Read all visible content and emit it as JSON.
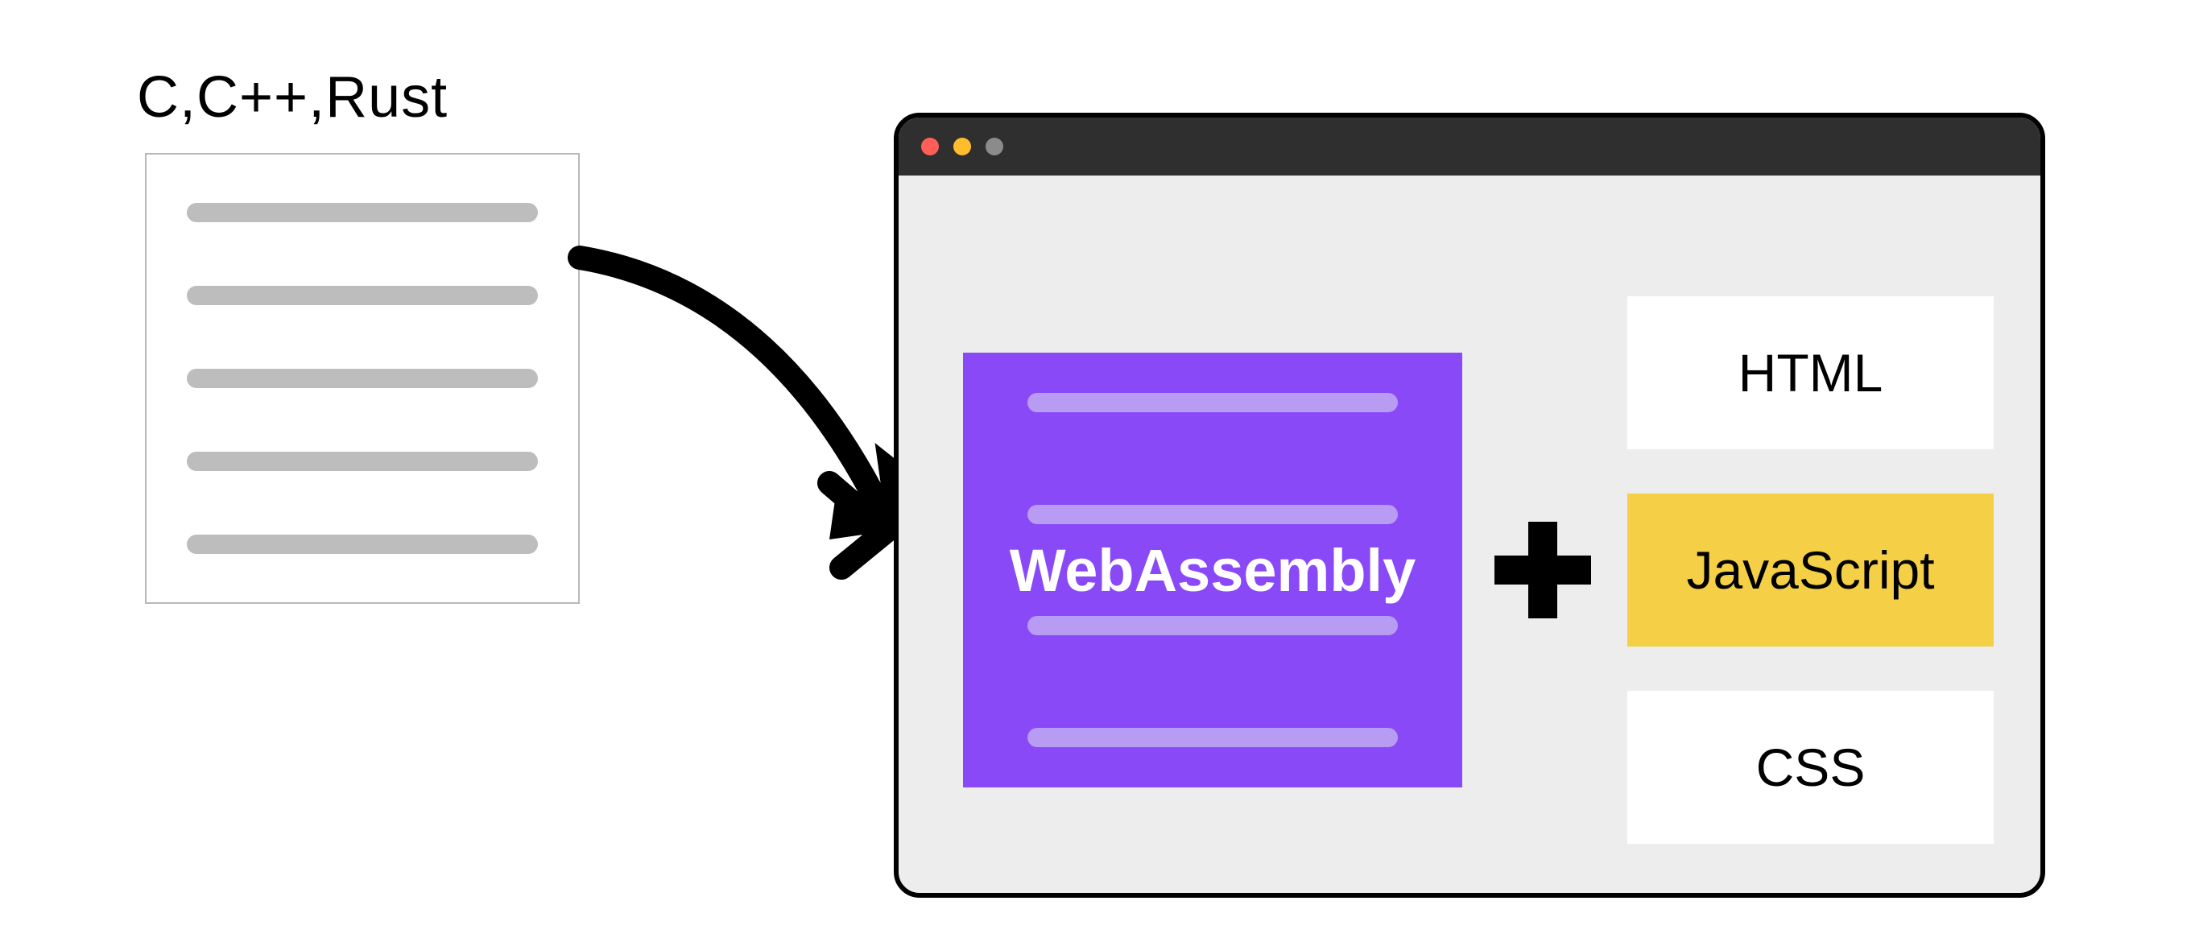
{
  "source": {
    "label": "C,C++,Rust"
  },
  "wasm": {
    "label": "WebAssembly"
  },
  "boxes": {
    "html": "HTML",
    "js": "JavaScript",
    "css": "CSS"
  }
}
